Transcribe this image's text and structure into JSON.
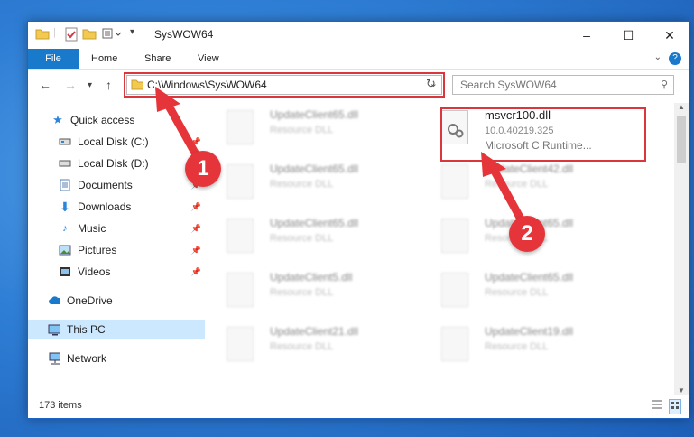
{
  "window": {
    "title": "SysWOW64",
    "controls": {
      "minimize": "–",
      "maximize": "☐",
      "close": "✕"
    }
  },
  "ribbon": {
    "tabs": [
      {
        "label": "File",
        "active": true
      },
      {
        "label": "Home"
      },
      {
        "label": "Share"
      },
      {
        "label": "View"
      }
    ],
    "help": "?"
  },
  "navbar": {
    "address": "C:\\Windows\\SysWOW64",
    "search_placeholder": "Search SysWOW64"
  },
  "sidebar": {
    "items": [
      {
        "label": "Quick access",
        "icon": "star-icon",
        "pinned": false
      },
      {
        "label": "Local Disk (C:)",
        "icon": "drive-icon",
        "pinned": true
      },
      {
        "label": "Local Disk (D:)",
        "icon": "drive-icon",
        "pinned": true
      },
      {
        "label": "Documents",
        "icon": "document-icon",
        "pinned": true
      },
      {
        "label": "Downloads",
        "icon": "download-icon",
        "pinned": true
      },
      {
        "label": "Music",
        "icon": "music-icon",
        "pinned": true
      },
      {
        "label": "Pictures",
        "icon": "pictures-icon",
        "pinned": true
      },
      {
        "label": "Videos",
        "icon": "videos-icon",
        "pinned": true
      },
      {
        "label": "OneDrive",
        "icon": "cloud-icon",
        "pinned": false
      },
      {
        "label": "This PC",
        "icon": "pc-icon",
        "pinned": false,
        "selected": true
      },
      {
        "label": "Network",
        "icon": "network-icon",
        "pinned": false
      }
    ]
  },
  "files": {
    "highlighted": {
      "name": "msvcr100.dll",
      "version": "10.0.40219.325",
      "description": "Microsoft C Runtime..."
    },
    "left_column": [
      {
        "name": "UpdateClient65.dll",
        "type": "Resource DLL"
      },
      {
        "name": "UpdateClient65.dll",
        "type": "Resource DLL"
      },
      {
        "name": "UpdateClient65.dll",
        "type": "Resource DLL"
      },
      {
        "name": "UpdateClient5.dll",
        "type": "Resource DLL"
      },
      {
        "name": "UpdateClient21.dll",
        "type": "Resource DLL"
      }
    ],
    "right_column": [
      {
        "name": "UpdateClient42.dll",
        "type": "Resource DLL"
      },
      {
        "name": "UpdateClient65.dll",
        "type": "Resource DLL"
      },
      {
        "name": "UpdateClient65.dll",
        "type": "Resource DLL"
      },
      {
        "name": "UpdateClient19.dll",
        "type": "Resource DLL"
      }
    ]
  },
  "status": {
    "count": "173 items"
  },
  "annotations": {
    "step1": "1",
    "step2": "2",
    "color": "#e5343a"
  }
}
